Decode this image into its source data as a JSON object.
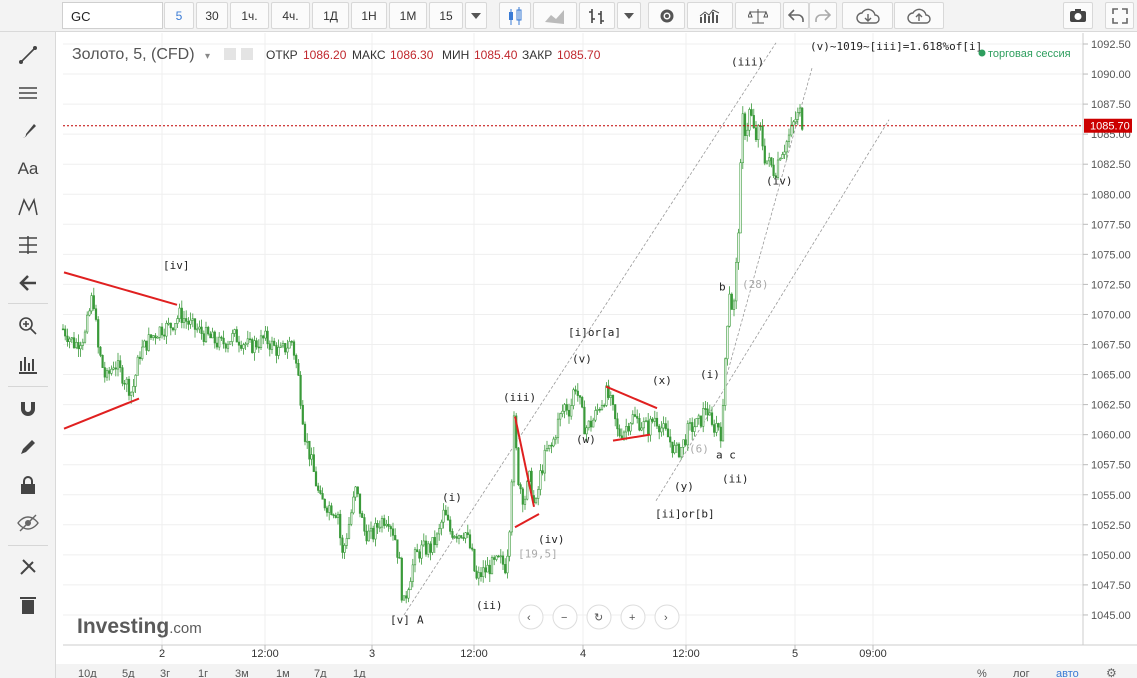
{
  "toolbar": {
    "symbol": "GC",
    "intervals": [
      "5",
      "30",
      "1ч.",
      "4ч.",
      "1Д",
      "1Н",
      "1М"
    ],
    "active_interval": "5",
    "count": "15"
  },
  "left_tools": [
    "crosshair-icon",
    "trendline-icon",
    "horizontal-lines-icon",
    "brush-icon",
    "text-tool-icon",
    "pattern-icon",
    "fib-icon",
    "back-arrow-icon",
    "zoom-icon",
    "measure-icon",
    "magnet-icon",
    "pencil-lock-icon",
    "lock-icon",
    "eye-icon",
    "tools-icon",
    "trash-icon"
  ],
  "header": {
    "title": "Золото, 5, (CFD)",
    "open_label": "ОТКР",
    "open": "1086.20",
    "high_label": "МАКС",
    "high": "1086.30",
    "low_label": "МИН",
    "low": "1085.40",
    "close_label": "ЗАКР",
    "close": "1085.70",
    "session": "торговая сессия"
  },
  "watermark": {
    "brand": "Investing",
    "suffix": ".com"
  },
  "bottom_ranges": [
    "10д",
    "5д",
    "3г",
    "1г",
    "3м",
    "1м",
    "7д",
    "1д"
  ],
  "bottom_right": {
    "percent": "%",
    "log": "лог",
    "auto": "авто"
  },
  "colors": {
    "candle": "#3a9a3a",
    "red_line": "#e02020",
    "price_line": "#c00000",
    "session_dot": "#2e9e5e",
    "price_tag_bg": "#cc0000"
  },
  "chart_data": {
    "type": "candlestick",
    "title": "Золото, 5, (CFD)",
    "xlabel": "",
    "ylabel": "",
    "ylim": [
      1043.4,
      1093.0
    ],
    "y_ticks": [
      1092.5,
      1090.0,
      1087.5,
      1085.0,
      1082.5,
      1080.0,
      1077.5,
      1075.0,
      1072.5,
      1070.0,
      1067.5,
      1065.0,
      1062.5,
      1060.0,
      1057.5,
      1055.0,
      1052.5,
      1050.0,
      1047.5,
      1045.0
    ],
    "x_ticks": [
      {
        "label": "2",
        "x": 162
      },
      {
        "label": "12:00",
        "x": 265
      },
      {
        "label": "3",
        "x": 372
      },
      {
        "label": "12:00",
        "x": 474
      },
      {
        "label": "4",
        "x": 583
      },
      {
        "label": "12:00",
        "x": 686
      },
      {
        "label": "5",
        "x": 795
      },
      {
        "label": "09:00",
        "x": 873
      }
    ],
    "current_price": 1085.7,
    "price_path": [
      [
        63,
        1068.8
      ],
      [
        75,
        1067.5
      ],
      [
        85,
        1068.3
      ],
      [
        93,
        1071.8
      ],
      [
        98,
        1067.2
      ],
      [
        106,
        1064.5
      ],
      [
        114,
        1066.0
      ],
      [
        122,
        1065.0
      ],
      [
        132,
        1063.5
      ],
      [
        140,
        1066.8
      ],
      [
        150,
        1068.0
      ],
      [
        160,
        1068.8
      ],
      [
        170,
        1069.0
      ],
      [
        180,
        1070.0
      ],
      [
        192,
        1069.0
      ],
      [
        205,
        1068.3
      ],
      [
        220,
        1067.5
      ],
      [
        235,
        1068.2
      ],
      [
        250,
        1067.3
      ],
      [
        265,
        1068.0
      ],
      [
        280,
        1066.8
      ],
      [
        292,
        1067.8
      ],
      [
        298,
        1065.0
      ],
      [
        305,
        1060.0
      ],
      [
        312,
        1057.5
      ],
      [
        320,
        1054.5
      ],
      [
        330,
        1054.0
      ],
      [
        338,
        1053.5
      ],
      [
        342,
        1049.8
      ],
      [
        350,
        1053.0
      ],
      [
        356,
        1055.5
      ],
      [
        364,
        1052.0
      ],
      [
        372,
        1051.5
      ],
      [
        380,
        1052.8
      ],
      [
        388,
        1053.2
      ],
      [
        395,
        1051.5
      ],
      [
        400,
        1049.0
      ],
      [
        403,
        1045.5
      ],
      [
        408,
        1047.5
      ],
      [
        415,
        1049.8
      ],
      [
        422,
        1050.5
      ],
      [
        430,
        1050.5
      ],
      [
        438,
        1051.5
      ],
      [
        444,
        1053.5
      ],
      [
        450,
        1052.0
      ],
      [
        458,
        1051.8
      ],
      [
        465,
        1052.0
      ],
      [
        472,
        1050.0
      ],
      [
        476,
        1047.8
      ],
      [
        482,
        1048.5
      ],
      [
        490,
        1049.0
      ],
      [
        500,
        1049.5
      ],
      [
        506,
        1049.0
      ],
      [
        510,
        1053.0
      ],
      [
        514,
        1061.0
      ],
      [
        518,
        1056.5
      ],
      [
        524,
        1054.5
      ],
      [
        530,
        1056.5
      ],
      [
        535,
        1053.5
      ],
      [
        540,
        1056.5
      ],
      [
        546,
        1058.5
      ],
      [
        552,
        1059.0
      ],
      [
        558,
        1061.0
      ],
      [
        565,
        1062.5
      ],
      [
        570,
        1062.0
      ],
      [
        575,
        1064.3
      ],
      [
        580,
        1062.5
      ],
      [
        585,
        1060.5
      ],
      [
        592,
        1061.0
      ],
      [
        600,
        1062.5
      ],
      [
        607,
        1063.5
      ],
      [
        612,
        1062.3
      ],
      [
        618,
        1060.0
      ],
      [
        625,
        1060.5
      ],
      [
        632,
        1061.5
      ],
      [
        640,
        1061.0
      ],
      [
        648,
        1060.5
      ],
      [
        655,
        1061.5
      ],
      [
        662,
        1060.5
      ],
      [
        668,
        1059.8
      ],
      [
        676,
        1058.5
      ],
      [
        682,
        1059.0
      ],
      [
        688,
        1060.3
      ],
      [
        695,
        1060.8
      ],
      [
        700,
        1061.0
      ],
      [
        706,
        1062.5
      ],
      [
        712,
        1060.5
      ],
      [
        718,
        1061.0
      ],
      [
        722,
        1059.8
      ],
      [
        726,
        1068.0
      ],
      [
        730,
        1072.5
      ],
      [
        733,
        1069.5
      ],
      [
        737,
        1075.0
      ],
      [
        740,
        1080.0
      ],
      [
        742,
        1086.5
      ],
      [
        746,
        1085.0
      ],
      [
        750,
        1087.2
      ],
      [
        755,
        1084.5
      ],
      [
        760,
        1085.5
      ],
      [
        765,
        1083.0
      ],
      [
        770,
        1082.5
      ],
      [
        775,
        1081.8
      ],
      [
        780,
        1083.5
      ],
      [
        785,
        1084.0
      ],
      [
        790,
        1085.0
      ],
      [
        795,
        1086.2
      ],
      [
        800,
        1086.8
      ],
      [
        803,
        1085.7
      ]
    ],
    "annotations": [
      {
        "text": "[iv]",
        "x": 163,
        "y": 1073.8
      },
      {
        "text": "[v]",
        "x": 390,
        "y": 1044.3
      },
      {
        "text": "A",
        "x": 417,
        "y": 1044.3
      },
      {
        "text": "(i)",
        "x": 442,
        "y": 1054.5
      },
      {
        "text": "(ii)",
        "x": 476,
        "y": 1045.5
      },
      {
        "text": "(iii)",
        "x": 503,
        "y": 1062.8
      },
      {
        "text": "(iv)",
        "x": 538,
        "y": 1051.0
      },
      {
        "text": "(v)",
        "x": 572,
        "y": 1066.0
      },
      {
        "text": "[i]or[a]",
        "x": 568,
        "y": 1068.2
      },
      {
        "text": "(w)",
        "x": 576,
        "y": 1059.3
      },
      {
        "text": "(x)",
        "x": 652,
        "y": 1064.2
      },
      {
        "text": "(y)",
        "x": 674,
        "y": 1055.4
      },
      {
        "text": "[ii]or[b]",
        "x": 655,
        "y": 1053.1
      },
      {
        "text": "(i)",
        "x": 700,
        "y": 1064.7
      },
      {
        "text": "(ii)",
        "x": 722,
        "y": 1056.0
      },
      {
        "text": "a c",
        "x": 716,
        "y": 1058.0
      },
      {
        "text": "b",
        "x": 719,
        "y": 1072.0
      },
      {
        "text": "(iii)",
        "x": 731,
        "y": 1090.7
      },
      {
        "text": "(iv)",
        "x": 766,
        "y": 1080.8
      },
      {
        "text": "(v)~1019~[iii]=1.618%of[i]",
        "x": 810,
        "y": 1092.0
      }
    ],
    "grey_annotations": [
      {
        "text": "[19,5]",
        "x": 518,
        "y": 1049.8
      },
      {
        "text": "(6)",
        "x": 689,
        "y": 1058.5
      },
      {
        "text": "(28)",
        "x": 742,
        "y": 1072.2
      }
    ],
    "red_lines": [
      [
        [
          64,
          1073.5
        ],
        [
          177,
          1070.8
        ]
      ],
      [
        [
          64,
          1060.5
        ],
        [
          139,
          1063.0
        ]
      ],
      [
        [
          515,
          1061.5
        ],
        [
          534,
          1054.0
        ]
      ],
      [
        [
          515,
          1052.3
        ],
        [
          539,
          1053.4
        ]
      ],
      [
        [
          606,
          1064.0
        ],
        [
          657,
          1062.2
        ]
      ],
      [
        [
          613,
          1059.5
        ],
        [
          650,
          1060.0
        ]
      ]
    ],
    "channel_lines": [
      [
        [
          404,
          1045.0
        ],
        [
          776,
          1092.6
        ]
      ],
      [
        [
          656,
          1054.5
        ],
        [
          889,
          1086.2
        ]
      ],
      [
        [
          727,
          1065.0
        ],
        [
          812,
          1090.5
        ]
      ]
    ]
  }
}
